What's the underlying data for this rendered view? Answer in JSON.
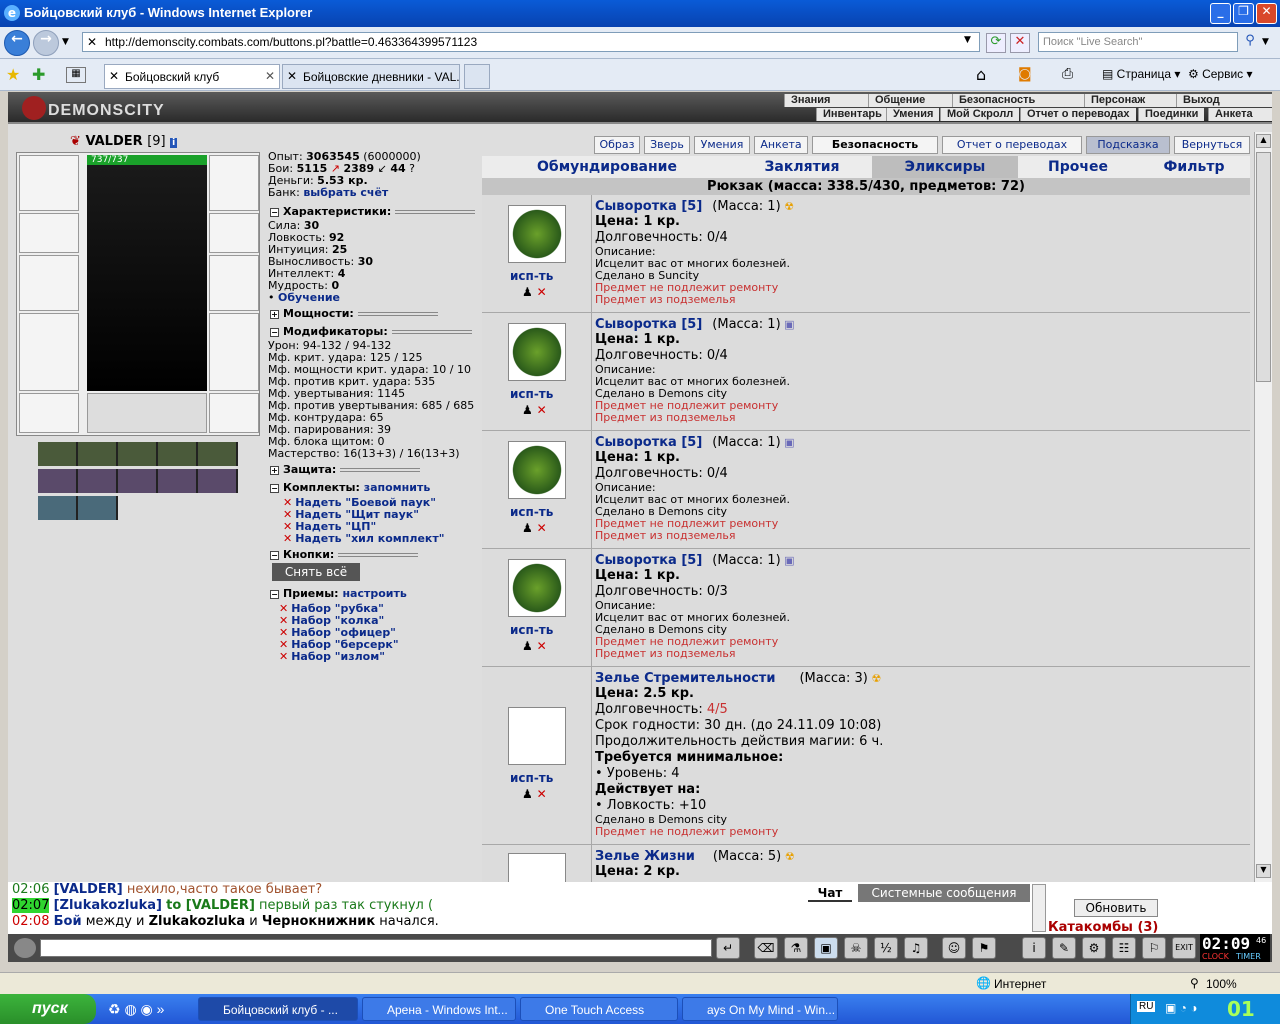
{
  "window": {
    "title": "Бойцовский клуб - Windows Internet Explorer"
  },
  "nav": {
    "url": "http://demonscity.combats.com/buttons.pl?battle=0.463364399571123",
    "search_placeholder": "Поиск \"Live Search\""
  },
  "tabs": [
    {
      "label": "Бойцовский клуб"
    },
    {
      "label": "Бойцовские дневники - VAL..."
    }
  ],
  "toolbar": {
    "page": "Страница",
    "service": "Сервис"
  },
  "site": {
    "logo": "DEMONSCITY",
    "menu_top": [
      "Знания",
      "Общение",
      "Безопасность",
      "Персонаж",
      "Выход"
    ],
    "menu_bottom": [
      "Инвентарь",
      "Умения",
      "Мой Скролл",
      "Отчет о переводах",
      "Поединки",
      "Анкета"
    ]
  },
  "character": {
    "name": "VALDER",
    "level": "[9]",
    "hp": "737/737"
  },
  "stats": {
    "exp_label": "Опыт:",
    "exp": "3063545",
    "exp_next": "(6000000)",
    "battles_label": "Бои:",
    "wins": "5115",
    "losses": "2389",
    "draws": "44",
    "money_label": "Деньги:",
    "money": "5.53 кр.",
    "bank_label": "Банк:",
    "bank": "выбрать счёт"
  },
  "characteristics": {
    "title": "Характеристики:",
    "rows": [
      {
        "label": "Сила:",
        "value": "30"
      },
      {
        "label": "Ловкость:",
        "value": "92"
      },
      {
        "label": "Интуиция:",
        "value": "25"
      },
      {
        "label": "Выносливость:",
        "value": "30"
      },
      {
        "label": "Интеллект:",
        "value": "4"
      },
      {
        "label": "Мудрость:",
        "value": "0"
      }
    ],
    "training": "Обучение"
  },
  "powers_title": "Мощности:",
  "modifiers": {
    "title": "Модификаторы:",
    "rows": [
      "Урон: 94-132 / 94-132",
      "Мф. крит. удара: 125 / 125",
      "Мф. мощности крит. удара: 10 / 10",
      "Мф. против крит. удара: 535",
      "Мф. увертывания: 1145",
      "Мф. против увертывания: 685 / 685",
      "Мф. контрудара: 65",
      "Мф. парирования: 39",
      "Мф. блока щитом: 0",
      "Мастерство: 16(13+3) / 16(13+3)"
    ]
  },
  "protection_title": "Защита:",
  "sets": {
    "title": "Комплекты:",
    "remember": "запомнить",
    "items": [
      "Надеть \"Боевой паук\"",
      "Надеть \"Щит паук\"",
      "Надеть \"ЦП\"",
      "Надеть \"хил комплект\""
    ]
  },
  "buttons_title": "Кнопки:",
  "undress": "Снять всё",
  "techniques": {
    "title": "Приемы:",
    "setup": "настроить",
    "items": [
      "Набор \"рубка\"",
      "Набор \"колка\"",
      "Набор \"офицер\"",
      "Набор \"берсерк\"",
      "Набор \"излом\""
    ]
  },
  "top_buttons": [
    "Образ",
    "Зверь",
    "Умения",
    "Анкета",
    "Безопасность",
    "Отчет о переводах",
    "Подсказка",
    "Вернуться"
  ],
  "inv_tabs": [
    "Обмундирование",
    "Заклятия",
    "Эликсиры",
    "Прочее",
    "Фильтр"
  ],
  "backpack": "Рюкзак (масса: 338.5/430, предметов: 72)",
  "use_label": "исп-ть",
  "items": [
    {
      "name": "Сыворотка [5]",
      "mass": "(Масса: 1)",
      "price": "Цена: 1 кр.",
      "dur_label": "Долговечность:",
      "dur": "0/4",
      "desc_label": "Описание:",
      "desc": "Исцелит вас от многих болезней.",
      "made": "Сделано в Suncity",
      "norepair": "Предмет не подлежит ремонту",
      "dungeon": "Предмет из подземелья"
    },
    {
      "name": "Сыворотка [5]",
      "mass": "(Масса: 1)",
      "price": "Цена: 1 кр.",
      "dur_label": "Долговечность:",
      "dur": "0/4",
      "desc_label": "Описание:",
      "desc": "Исцелит вас от многих болезней.",
      "made": "Сделано в Demons city",
      "norepair": "Предмет не подлежит ремонту",
      "dungeon": "Предмет из подземелья"
    },
    {
      "name": "Сыворотка [5]",
      "mass": "(Масса: 1)",
      "price": "Цена: 1 кр.",
      "dur_label": "Долговечность:",
      "dur": "0/4",
      "desc_label": "Описание:",
      "desc": "Исцелит вас от многих болезней.",
      "made": "Сделано в Demons city",
      "norepair": "Предмет не подлежит ремонту",
      "dungeon": "Предмет из подземелья"
    },
    {
      "name": "Сыворотка [5]",
      "mass": "(Масса: 1)",
      "price": "Цена: 1 кр.",
      "dur_label": "Долговечность:",
      "dur": "0/3",
      "desc_label": "Описание:",
      "desc": "Исцелит вас от многих болезней.",
      "made": "Сделано в Demons city",
      "norepair": "Предмет не подлежит ремонту",
      "dungeon": "Предмет из подземелья"
    }
  ],
  "item5": {
    "name": "Зелье Стремительности",
    "mass": "(Масса: 3)",
    "price": "Цена: 2.5 кр.",
    "dur_label": "Долговечность:",
    "dur": "4/5",
    "expiry": "Срок годности: 30 дн. (до 24.11.09 10:08)",
    "duration": "Продолжительность действия магии: 6 ч.",
    "req_title": "Требуется минимальное:",
    "req": "• Уровень: 4",
    "affects_title": "Действует на:",
    "affects": "• Ловкость: +10",
    "made": "Сделано в Demons city",
    "norepair": "Предмет не подлежит ремонту"
  },
  "item6": {
    "name": "Зелье Жизни",
    "mass": "(Масса: 5)",
    "price": "Цена: 2 кр."
  },
  "chat": {
    "lines": [
      {
        "time": "02:06",
        "who": "[VALDER]",
        "text": "нехило,часто такое бывает?"
      },
      {
        "time": "02:07",
        "who": "[Zlukakozluka]",
        "to": "to [VALDER]",
        "text": "первый раз так стукнул ("
      },
      {
        "time": "02:08",
        "who": "Бой",
        "text1": "между и",
        "p1": "Zlukakozluka",
        "text2": "и",
        "p2": "Чернокнижник",
        "text3": "начался."
      }
    ],
    "tab_chat": "Чат",
    "tab_system": "Системные сообщения",
    "refresh": "Обновить",
    "location": "Катакомбы (3)"
  },
  "clock": {
    "time": "02:09",
    "sec": "46",
    "clock_label": "CLOCK",
    "timer_label": "TIMER"
  },
  "statusbar": {
    "zone": "Интернет",
    "zoom": "100%"
  },
  "taskbar": {
    "start": "пуск",
    "tasks": [
      "Бойцовский клуб - ...",
      "Арена - Windows Int...",
      "One Touch Access",
      "ays On My Mind - Win..."
    ],
    "lang": "RU",
    "time": "01"
  }
}
